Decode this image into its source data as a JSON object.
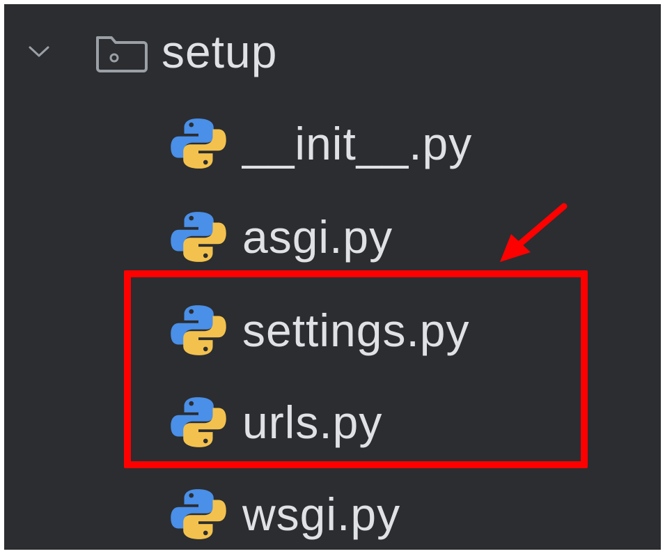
{
  "tree": {
    "folder": {
      "name": "setup",
      "expanded": true,
      "chevron_icon": "chevron-down-icon",
      "icon": "folder-package-icon"
    },
    "files": [
      {
        "name": "__init__.py",
        "icon": "python-icon"
      },
      {
        "name": "asgi.py",
        "icon": "python-icon"
      },
      {
        "name": "settings.py",
        "icon": "python-icon"
      },
      {
        "name": "urls.py",
        "icon": "python-icon"
      },
      {
        "name": "wsgi.py",
        "icon": "python-icon"
      }
    ]
  },
  "annotation": {
    "highlighted_files": [
      "settings.py",
      "urls.py"
    ],
    "color": "#ff0000"
  },
  "colors": {
    "background": "#2b2d30",
    "text": "#dfe1e5",
    "python_blue": "#4a8fe8",
    "python_yellow": "#f3c24e"
  }
}
